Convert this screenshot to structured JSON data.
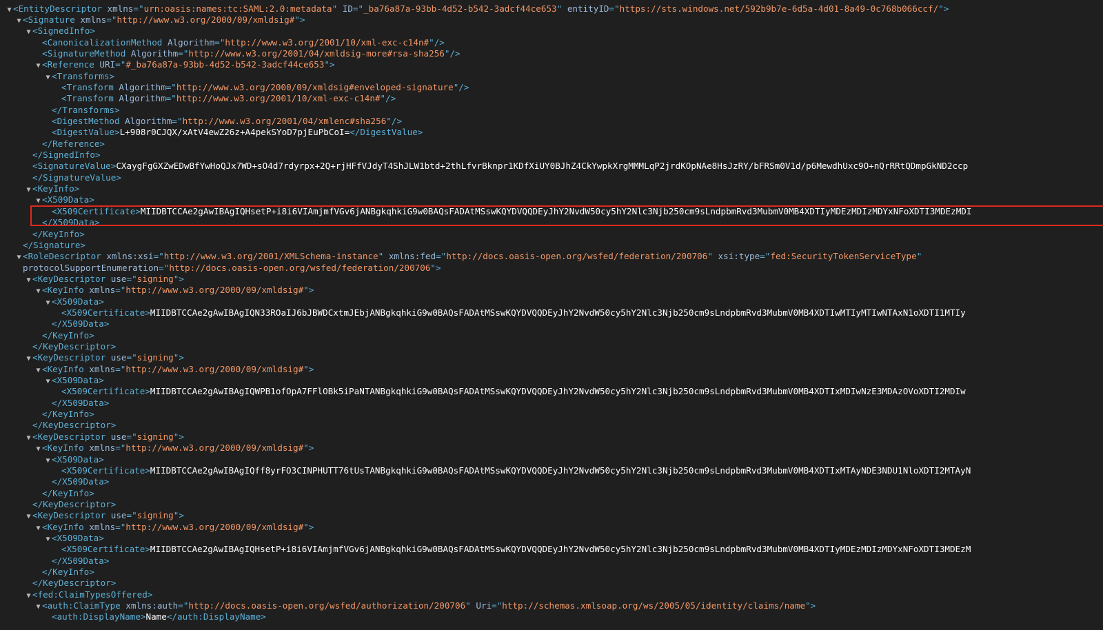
{
  "colors": {
    "background": "#1f1f1f",
    "tag": "#5db0d7",
    "attr_name": "#9bbbdc",
    "attr_value": "#f29766",
    "text": "#ffffff",
    "highlight_border": "#e0291c"
  },
  "toggle_icon": "triangle-down",
  "lines": [
    {
      "i": 0,
      "tw": 1,
      "p": [
        [
          "t",
          "<EntityDescriptor"
        ],
        [
          "s",
          " "
        ],
        [
          "an",
          "xmlns"
        ],
        [
          "t",
          "=\""
        ],
        [
          "av",
          "urn:oasis:names:tc:SAML:2.0:metadata"
        ],
        [
          "t",
          "\""
        ],
        [
          "s",
          " "
        ],
        [
          "an",
          "ID"
        ],
        [
          "t",
          "=\""
        ],
        [
          "av",
          "_ba76a87a-93bb-4d52-b542-3adcf44ce653"
        ],
        [
          "t",
          "\""
        ],
        [
          "s",
          " "
        ],
        [
          "an",
          "entityID"
        ],
        [
          "t",
          "=\""
        ],
        [
          "av",
          "https://sts.windows.net/592b9b7e-6d5a-4d01-8a49-0c768b066ccf/"
        ],
        [
          "t",
          "\">"
        ]
      ]
    },
    {
      "i": 1,
      "tw": 1,
      "p": [
        [
          "t",
          "<Signature"
        ],
        [
          "s",
          " "
        ],
        [
          "an",
          "xmlns"
        ],
        [
          "t",
          "=\""
        ],
        [
          "av",
          "http://www.w3.org/2000/09/xmldsig#"
        ],
        [
          "t",
          "\">"
        ]
      ]
    },
    {
      "i": 2,
      "tw": 1,
      "p": [
        [
          "t",
          "<SignedInfo>"
        ]
      ]
    },
    {
      "i": 3,
      "tw": 0,
      "p": [
        [
          "t",
          "<CanonicalizationMethod"
        ],
        [
          "s",
          " "
        ],
        [
          "an",
          "Algorithm"
        ],
        [
          "t",
          "=\""
        ],
        [
          "av",
          "http://www.w3.org/2001/10/xml-exc-c14n#"
        ],
        [
          "t",
          "\"/>"
        ]
      ]
    },
    {
      "i": 3,
      "tw": 0,
      "p": [
        [
          "t",
          "<SignatureMethod"
        ],
        [
          "s",
          " "
        ],
        [
          "an",
          "Algorithm"
        ],
        [
          "t",
          "=\""
        ],
        [
          "av",
          "http://www.w3.org/2001/04/xmldsig-more#rsa-sha256"
        ],
        [
          "t",
          "\"/>"
        ]
      ]
    },
    {
      "i": 3,
      "tw": 1,
      "p": [
        [
          "t",
          "<Reference"
        ],
        [
          "s",
          " "
        ],
        [
          "an",
          "URI"
        ],
        [
          "t",
          "=\""
        ],
        [
          "av",
          "#_ba76a87a-93bb-4d52-b542-3adcf44ce653"
        ],
        [
          "t",
          "\">"
        ]
      ]
    },
    {
      "i": 4,
      "tw": 1,
      "p": [
        [
          "t",
          "<Transforms>"
        ]
      ]
    },
    {
      "i": 5,
      "tw": 0,
      "p": [
        [
          "t",
          "<Transform"
        ],
        [
          "s",
          " "
        ],
        [
          "an",
          "Algorithm"
        ],
        [
          "t",
          "=\""
        ],
        [
          "av",
          "http://www.w3.org/2000/09/xmldsig#enveloped-signature"
        ],
        [
          "t",
          "\"/>"
        ]
      ]
    },
    {
      "i": 5,
      "tw": 0,
      "p": [
        [
          "t",
          "<Transform"
        ],
        [
          "s",
          " "
        ],
        [
          "an",
          "Algorithm"
        ],
        [
          "t",
          "=\""
        ],
        [
          "av",
          "http://www.w3.org/2001/10/xml-exc-c14n#"
        ],
        [
          "t",
          "\"/>"
        ]
      ]
    },
    {
      "i": 4,
      "tw": 0,
      "p": [
        [
          "t",
          "</Transforms>"
        ]
      ]
    },
    {
      "i": 4,
      "tw": 0,
      "p": [
        [
          "t",
          "<DigestMethod"
        ],
        [
          "s",
          " "
        ],
        [
          "an",
          "Algorithm"
        ],
        [
          "t",
          "=\""
        ],
        [
          "av",
          "http://www.w3.org/2001/04/xmlenc#sha256"
        ],
        [
          "t",
          "\"/>"
        ]
      ]
    },
    {
      "i": 4,
      "tw": 0,
      "p": [
        [
          "t",
          "<DigestValue>"
        ],
        [
          "tx",
          "L+908r0CJQX/xAtV4ewZ26z+A4pekSYoD7pjEuPbCoI="
        ],
        [
          "t",
          "</DigestValue>"
        ]
      ]
    },
    {
      "i": 3,
      "tw": 0,
      "p": [
        [
          "t",
          "</Reference>"
        ]
      ]
    },
    {
      "i": 2,
      "tw": 0,
      "p": [
        [
          "t",
          "</SignedInfo>"
        ]
      ]
    },
    {
      "i": 2,
      "tw": 0,
      "p": [
        [
          "t",
          "<SignatureValue>"
        ],
        [
          "tx",
          "CXaygFgGXZwEDwBfYwHoQJx7WD+sO4d7rdyrpx+2Q+rjHFfVJdyT4ShJLW1btd+2thLfvrBknpr1KDfXiUY0BJhZ4CkYwpkXrgMMMLqP2jrdKOpNAe8HsJzRY/bFRSm0V1d/p6MewdhUxc9O+nQrRRtQDmpGkND2ccp"
        ]
      ]
    },
    {
      "i": 2,
      "tw": 0,
      "p": [
        [
          "t",
          "</SignatureValue>"
        ]
      ]
    },
    {
      "i": 2,
      "tw": 1,
      "p": [
        [
          "t",
          "<KeyInfo>"
        ]
      ]
    },
    {
      "i": 3,
      "tw": 1,
      "p": [
        [
          "t",
          "<X509Data>"
        ]
      ]
    },
    {
      "i": 4,
      "tw": 0,
      "hl": 1,
      "p": [
        [
          "t",
          "<X509Certificate>"
        ],
        [
          "tx",
          "MIIDBTCCAe2gAwIBAgIQHsetP+i8i6VIAmjmfVGv6jANBgkqhkiG9w0BAQsFADAtMSswKQYDVQQDEyJhY2NvdW50cy5hY2Nlc3Njb250cm9sLndpbmRvd3MubmV0MB4XDTIyMDEzMDIzMDYxNFoXDTI3MDEzMDI"
        ]
      ]
    },
    {
      "i": 3,
      "tw": 0,
      "p": [
        [
          "t",
          "</X509Data>"
        ]
      ]
    },
    {
      "i": 2,
      "tw": 0,
      "p": [
        [
          "t",
          "</KeyInfo>"
        ]
      ]
    },
    {
      "i": 1,
      "tw": 0,
      "p": [
        [
          "t",
          "</Signature>"
        ]
      ]
    },
    {
      "i": 1,
      "tw": 1,
      "p": [
        [
          "t",
          "<RoleDescriptor"
        ],
        [
          "s",
          " "
        ],
        [
          "an",
          "xmlns:xsi"
        ],
        [
          "t",
          "=\""
        ],
        [
          "av",
          "http://www.w3.org/2001/XMLSchema-instance"
        ],
        [
          "t",
          "\""
        ],
        [
          "s",
          " "
        ],
        [
          "an",
          "xmlns:fed"
        ],
        [
          "t",
          "=\""
        ],
        [
          "av",
          "http://docs.oasis-open.org/wsfed/federation/200706"
        ],
        [
          "t",
          "\""
        ],
        [
          "s",
          " "
        ],
        [
          "an",
          "xsi:type"
        ],
        [
          "t",
          "=\""
        ],
        [
          "av",
          "fed:SecurityTokenServiceType"
        ],
        [
          "t",
          "\""
        ]
      ]
    },
    {
      "i": 1,
      "tw": 0,
      "np": 1,
      "p": [
        [
          "an",
          "protocolSupportEnumeration"
        ],
        [
          "t",
          "=\""
        ],
        [
          "av",
          "http://docs.oasis-open.org/wsfed/federation/200706"
        ],
        [
          "t",
          "\">"
        ]
      ]
    },
    {
      "i": 2,
      "tw": 1,
      "p": [
        [
          "t",
          "<KeyDescriptor"
        ],
        [
          "s",
          " "
        ],
        [
          "an",
          "use"
        ],
        [
          "t",
          "=\""
        ],
        [
          "av",
          "signing"
        ],
        [
          "t",
          "\">"
        ]
      ]
    },
    {
      "i": 3,
      "tw": 1,
      "p": [
        [
          "t",
          "<KeyInfo"
        ],
        [
          "s",
          " "
        ],
        [
          "an",
          "xmlns"
        ],
        [
          "t",
          "=\""
        ],
        [
          "av",
          "http://www.w3.org/2000/09/xmldsig#"
        ],
        [
          "t",
          "\">"
        ]
      ]
    },
    {
      "i": 4,
      "tw": 1,
      "p": [
        [
          "t",
          "<X509Data>"
        ]
      ]
    },
    {
      "i": 5,
      "tw": 0,
      "p": [
        [
          "t",
          "<X509Certificate>"
        ],
        [
          "tx",
          "MIIDBTCCAe2gAwIBAgIQN33ROaIJ6bJBWDCxtmJEbjANBgkqhkiG9w0BAQsFADAtMSswKQYDVQQDEyJhY2NvdW50cy5hY2Nlc3Njb250cm9sLndpbmRvd3MubmV0MB4XDTIwMTIyMTIwNTAxN1oXDTI1MTIy"
        ]
      ]
    },
    {
      "i": 4,
      "tw": 0,
      "p": [
        [
          "t",
          "</X509Data>"
        ]
      ]
    },
    {
      "i": 3,
      "tw": 0,
      "p": [
        [
          "t",
          "</KeyInfo>"
        ]
      ]
    },
    {
      "i": 2,
      "tw": 0,
      "p": [
        [
          "t",
          "</KeyDescriptor>"
        ]
      ]
    },
    {
      "i": 2,
      "tw": 1,
      "p": [
        [
          "t",
          "<KeyDescriptor"
        ],
        [
          "s",
          " "
        ],
        [
          "an",
          "use"
        ],
        [
          "t",
          "=\""
        ],
        [
          "av",
          "signing"
        ],
        [
          "t",
          "\">"
        ]
      ]
    },
    {
      "i": 3,
      "tw": 1,
      "p": [
        [
          "t",
          "<KeyInfo"
        ],
        [
          "s",
          " "
        ],
        [
          "an",
          "xmlns"
        ],
        [
          "t",
          "=\""
        ],
        [
          "av",
          "http://www.w3.org/2000/09/xmldsig#"
        ],
        [
          "t",
          "\">"
        ]
      ]
    },
    {
      "i": 4,
      "tw": 1,
      "p": [
        [
          "t",
          "<X509Data>"
        ]
      ]
    },
    {
      "i": 5,
      "tw": 0,
      "p": [
        [
          "t",
          "<X509Certificate>"
        ],
        [
          "tx",
          "MIIDBTCCAe2gAwIBAgIQWPB1ofOpA7FFlOBk5iPaNTANBgkqhkiG9w0BAQsFADAtMSswKQYDVQQDEyJhY2NvdW50cy5hY2Nlc3Njb250cm9sLndpbmRvd3MubmV0MB4XDTIxMDIwNzE3MDAzOVoXDTI2MDIw"
        ]
      ]
    },
    {
      "i": 4,
      "tw": 0,
      "p": [
        [
          "t",
          "</X509Data>"
        ]
      ]
    },
    {
      "i": 3,
      "tw": 0,
      "p": [
        [
          "t",
          "</KeyInfo>"
        ]
      ]
    },
    {
      "i": 2,
      "tw": 0,
      "p": [
        [
          "t",
          "</KeyDescriptor>"
        ]
      ]
    },
    {
      "i": 2,
      "tw": 1,
      "p": [
        [
          "t",
          "<KeyDescriptor"
        ],
        [
          "s",
          " "
        ],
        [
          "an",
          "use"
        ],
        [
          "t",
          "=\""
        ],
        [
          "av",
          "signing"
        ],
        [
          "t",
          "\">"
        ]
      ]
    },
    {
      "i": 3,
      "tw": 1,
      "p": [
        [
          "t",
          "<KeyInfo"
        ],
        [
          "s",
          " "
        ],
        [
          "an",
          "xmlns"
        ],
        [
          "t",
          "=\""
        ],
        [
          "av",
          "http://www.w3.org/2000/09/xmldsig#"
        ],
        [
          "t",
          "\">"
        ]
      ]
    },
    {
      "i": 4,
      "tw": 1,
      "p": [
        [
          "t",
          "<X509Data>"
        ]
      ]
    },
    {
      "i": 5,
      "tw": 0,
      "p": [
        [
          "t",
          "<X509Certificate>"
        ],
        [
          "tx",
          "MIIDBTCCAe2gAwIBAgIQff8yrFO3CINPHUTT76tUsTANBgkqhkiG9w0BAQsFADAtMSswKQYDVQQDEyJhY2NvdW50cy5hY2Nlc3Njb250cm9sLndpbmRvd3MubmV0MB4XDTIxMTAyNDE3NDU1NloXDTI2MTAyN"
        ]
      ]
    },
    {
      "i": 4,
      "tw": 0,
      "p": [
        [
          "t",
          "</X509Data>"
        ]
      ]
    },
    {
      "i": 3,
      "tw": 0,
      "p": [
        [
          "t",
          "</KeyInfo>"
        ]
      ]
    },
    {
      "i": 2,
      "tw": 0,
      "p": [
        [
          "t",
          "</KeyDescriptor>"
        ]
      ]
    },
    {
      "i": 2,
      "tw": 1,
      "p": [
        [
          "t",
          "<KeyDescriptor"
        ],
        [
          "s",
          " "
        ],
        [
          "an",
          "use"
        ],
        [
          "t",
          "=\""
        ],
        [
          "av",
          "signing"
        ],
        [
          "t",
          "\">"
        ]
      ]
    },
    {
      "i": 3,
      "tw": 1,
      "p": [
        [
          "t",
          "<KeyInfo"
        ],
        [
          "s",
          " "
        ],
        [
          "an",
          "xmlns"
        ],
        [
          "t",
          "=\""
        ],
        [
          "av",
          "http://www.w3.org/2000/09/xmldsig#"
        ],
        [
          "t",
          "\">"
        ]
      ]
    },
    {
      "i": 4,
      "tw": 1,
      "p": [
        [
          "t",
          "<X509Data>"
        ]
      ]
    },
    {
      "i": 5,
      "tw": 0,
      "p": [
        [
          "t",
          "<X509Certificate>"
        ],
        [
          "tx",
          "MIIDBTCCAe2gAwIBAgIQHsetP+i8i6VIAmjmfVGv6jANBgkqhkiG9w0BAQsFADAtMSswKQYDVQQDEyJhY2NvdW50cy5hY2Nlc3Njb250cm9sLndpbmRvd3MubmV0MB4XDTIyMDEzMDIzMDYxNFoXDTI3MDEzM"
        ]
      ]
    },
    {
      "i": 4,
      "tw": 0,
      "p": [
        [
          "t",
          "</X509Data>"
        ]
      ]
    },
    {
      "i": 3,
      "tw": 0,
      "p": [
        [
          "t",
          "</KeyInfo>"
        ]
      ]
    },
    {
      "i": 2,
      "tw": 0,
      "p": [
        [
          "t",
          "</KeyDescriptor>"
        ]
      ]
    },
    {
      "i": 2,
      "tw": 1,
      "p": [
        [
          "t",
          "<fed:ClaimTypesOffered>"
        ]
      ]
    },
    {
      "i": 3,
      "tw": 1,
      "p": [
        [
          "t",
          "<auth:ClaimType"
        ],
        [
          "s",
          " "
        ],
        [
          "an",
          "xmlns:auth"
        ],
        [
          "t",
          "=\""
        ],
        [
          "av",
          "http://docs.oasis-open.org/wsfed/authorization/200706"
        ],
        [
          "t",
          "\""
        ],
        [
          "s",
          " "
        ],
        [
          "an",
          "Uri"
        ],
        [
          "t",
          "=\""
        ],
        [
          "av",
          "http://schemas.xmlsoap.org/ws/2005/05/identity/claims/name"
        ],
        [
          "t",
          "\">"
        ]
      ]
    },
    {
      "i": 4,
      "tw": 0,
      "p": [
        [
          "t",
          "<auth:DisplayName>"
        ],
        [
          "tx",
          "Name"
        ],
        [
          "t",
          "</auth:DisplayName>"
        ]
      ]
    }
  ]
}
